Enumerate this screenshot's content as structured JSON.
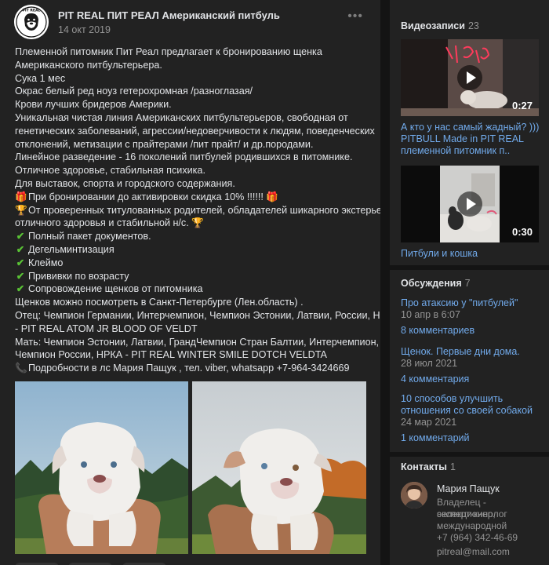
{
  "post": {
    "avatar_text": "PIT REAL",
    "title": "PIT REAL ПИТ РЕАЛ Американский питбуль",
    "date": "14 окт 2019",
    "more_icon": "more-dots-icon",
    "lines": [
      "Племенной питомник Пит Реал предлагает к бронированию щенка",
      "Американского питбультерьера.",
      "Сука 1 мес",
      "Окрас белый ред ноуз гетерохромная /разноглазая/",
      "Крови лучших бридеров Америки.",
      "Уникальная чистая линия Американских питбультерьеров, свободная от",
      "генетических заболеваний, агрессии/недоверчивости к людям, поведенческих",
      "отклонений, метизации с прайтерами /пит прайт/ и др.породами.",
      "Линейное разведение - 16 поколений питбулей родившихся в питомнике.",
      "Отличное здоровье, стабильная психика.",
      "Для выставок, спорта и городского содержания."
    ],
    "gift_line": "При бронировании до активировки скидка 10% !!!!!!",
    "trophy_line_1": "От проверенных титулованных родителей, обладателей шикарного экстерьера,",
    "trophy_line_2": "отличного здоровья и стабильной н/с.",
    "checklist": [
      "Полный пакет документов.",
      "Дегельминтизация",
      "Клеймо",
      "Прививки по возрасту",
      "Сопровождение щенков от питомника"
    ],
    "tail_lines": [
      "Щенков можно посмотреть в Санкт-Петербурге (Лен.область) .",
      "Отец: Чемпион Германии, Интерчемпион, Чемпион Эстонии, Латвии, России, НРКА",
      "- PIT REAL ATOM JR BLOOD OF VELDT",
      "Мать: Чемпион Эстонии, Латвии, ГрандЧемпион Стран Балтии, Интерчемпион,",
      "Чемпион России, НРКА - PIT REAL WINTER SMILE DOTCH VELDTA"
    ],
    "phone_line": "Подробности в лс Мария Пащук , тел. viber, whatsapp +7-964-3424669",
    "icons": {
      "check": "check-mark-icon",
      "trophy": "trophy-icon",
      "gift": "gift-icon",
      "phone": "phone-icon"
    }
  },
  "videos": {
    "title": "Видеозаписи",
    "count": "23",
    "items": [
      {
        "duration": "0:27",
        "title": "А кто у нас самый жадный? ))) PITBULL Made in PIT REAL племенной питомник п..",
        "overlay_text": "Pit Real"
      },
      {
        "duration": "0:30",
        "title": "Питбули и кошка"
      }
    ]
  },
  "discussions": {
    "title": "Обсуждения",
    "count": "7",
    "items": [
      {
        "title": "Про атаксию у \"питбулей\"",
        "date": "10 апр в 6:07",
        "comments": "8 комментариев"
      },
      {
        "title": "Щенок. Первые дни дома.",
        "date": "28 июл 2021",
        "comments": "4 комментария"
      },
      {
        "title": "10 способов улучшить отношения со своей собакой",
        "date": "24 мар 2021",
        "comments": "1 комментарий"
      }
    ]
  },
  "contacts": {
    "title": "Контакты",
    "count": "1",
    "name": "Мария Пащук",
    "role_lines": [
      "Владелец - селекционер,",
      "эксперт-кинолог",
      "международной"
    ],
    "phone": "+7 (964) 342-46-69",
    "email": "pitreal@mail.com"
  },
  "colors": {
    "background": "#141414",
    "card": "#222222",
    "link": "#71aaeb",
    "text": "#e1e3e6",
    "muted": "#939393",
    "check": "#59c135"
  }
}
